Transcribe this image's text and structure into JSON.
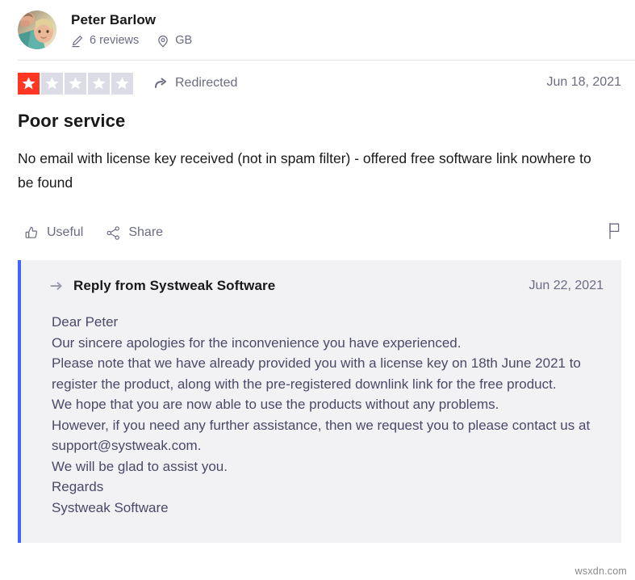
{
  "consumer": {
    "name": "Peter Barlow",
    "avatar_icon": "user-photo-avatar",
    "reviews_count_label": "6 reviews",
    "reviews_icon": "pencil-icon",
    "country_label": "GB",
    "country_icon": "location-pin-icon"
  },
  "rating": {
    "value": 1,
    "max": 5,
    "filled_color": "#ff3722",
    "empty_color": "#dcdce6",
    "star_glyph_color": "#ffffff"
  },
  "redirected": {
    "label": "Redirected",
    "icon": "redirect-arrow-icon"
  },
  "review": {
    "date": "Jun 18, 2021",
    "title": "Poor service",
    "body": "No email with license key received (not in spam filter) - offered free software link nowhere to be found"
  },
  "actions": {
    "useful_label": "Useful",
    "useful_icon": "thumbs-up-icon",
    "share_label": "Share",
    "share_icon": "share-icon",
    "report_icon": "flag-icon"
  },
  "reply": {
    "arrow_icon": "reply-arrow-icon",
    "title": "Reply from Systweak Software",
    "date": "Jun 22, 2021",
    "accent_color": "#4066ff",
    "background_color": "#f2f2f5",
    "lines": [
      "Dear Peter",
      "Our sincere apologies for the inconvenience you have experienced.",
      "Please note that we have already provided you with a license key on 18th June 2021 to register the product, along with the pre-registered downlink link for the free product.",
      "We hope that you are now able to use the products without any problems.",
      "However, if you need any further assistance, then we request you to please contact us at support@systweak.com.",
      "We will be glad to assist you.",
      "Regards",
      "Systweak Software"
    ]
  },
  "watermark": {
    "text": "wsxdn.com"
  }
}
